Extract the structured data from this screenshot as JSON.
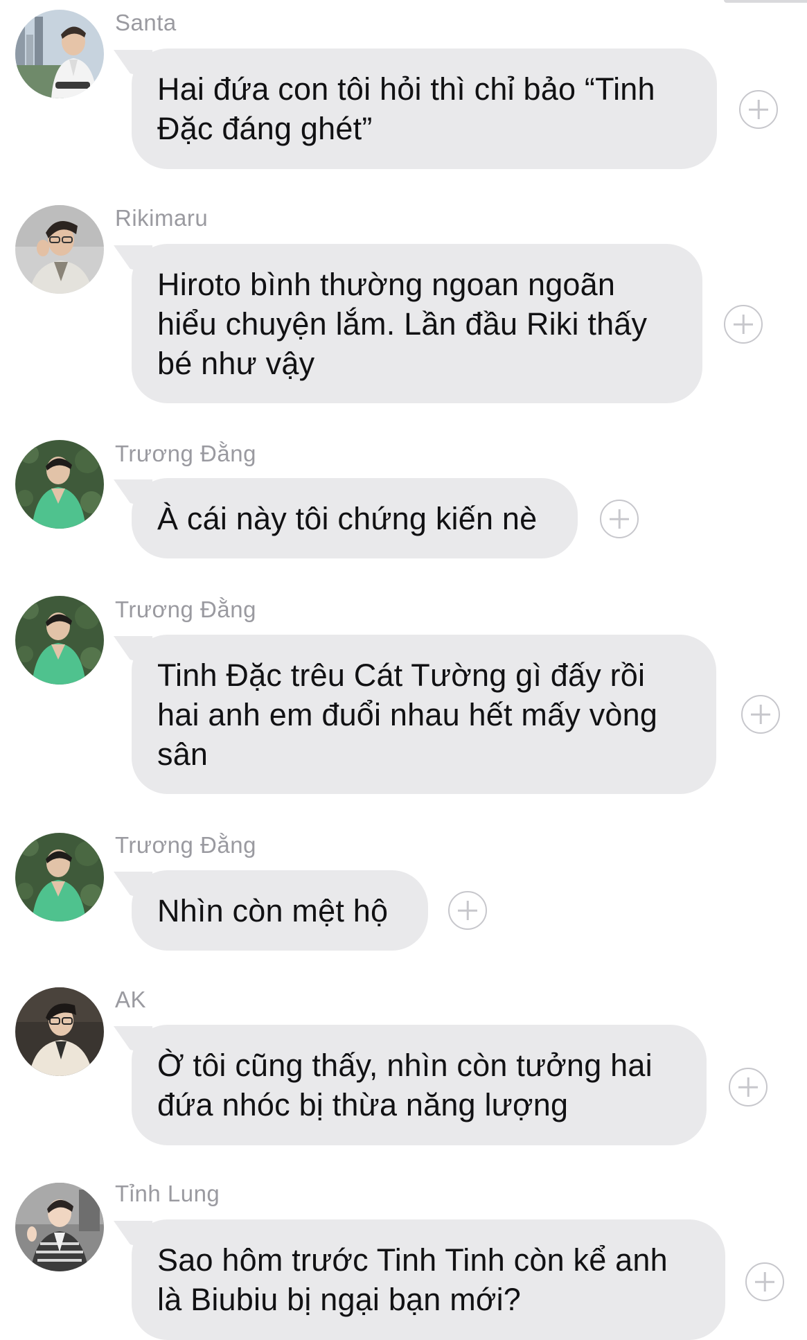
{
  "messages": [
    {
      "sender": "Santa",
      "avatar_icon": "person-photo-santa",
      "text": "Hai đứa con tôi hỏi thì chỉ bảo “Tinh\nĐặc đáng ghét”"
    },
    {
      "sender": "Rikimaru",
      "avatar_icon": "person-photo-rikimaru",
      "text": "Hiroto bình thường ngoan ngoãn\nhiểu chuyện lắm. Lần đầu Riki thấy\nbé như vậy"
    },
    {
      "sender": "Trương Đằng",
      "avatar_icon": "person-photo-truong-dang",
      "text": "À cái này tôi chứng kiến nè"
    },
    {
      "sender": "Trương Đằng",
      "avatar_icon": "person-photo-truong-dang",
      "text": "Tinh Đặc trêu Cát Tường gì đấy rồi\nhai anh em đuổi nhau hết mấy vòng\nsân"
    },
    {
      "sender": "Trương Đằng",
      "avatar_icon": "person-photo-truong-dang",
      "text": "Nhìn còn mệt hộ"
    },
    {
      "sender": "AK",
      "avatar_icon": "person-photo-ak",
      "text": "Ờ tôi cũng thấy, nhìn còn tưởng hai\nđứa nhóc bị thừa năng lượng"
    },
    {
      "sender": "Tỉnh Lung",
      "avatar_icon": "person-photo-tinh-lung",
      "text": "Sao hôm trước Tinh Tinh còn kể anh\nlà Biubiu bị ngại bạn mới?"
    }
  ],
  "reaction_icon": "add-reaction-icon",
  "colors": {
    "bubble": "#e9e9eb",
    "sender_name": "#9a9aa0",
    "text": "#111113",
    "icon_stroke": "#c7c7cc"
  }
}
